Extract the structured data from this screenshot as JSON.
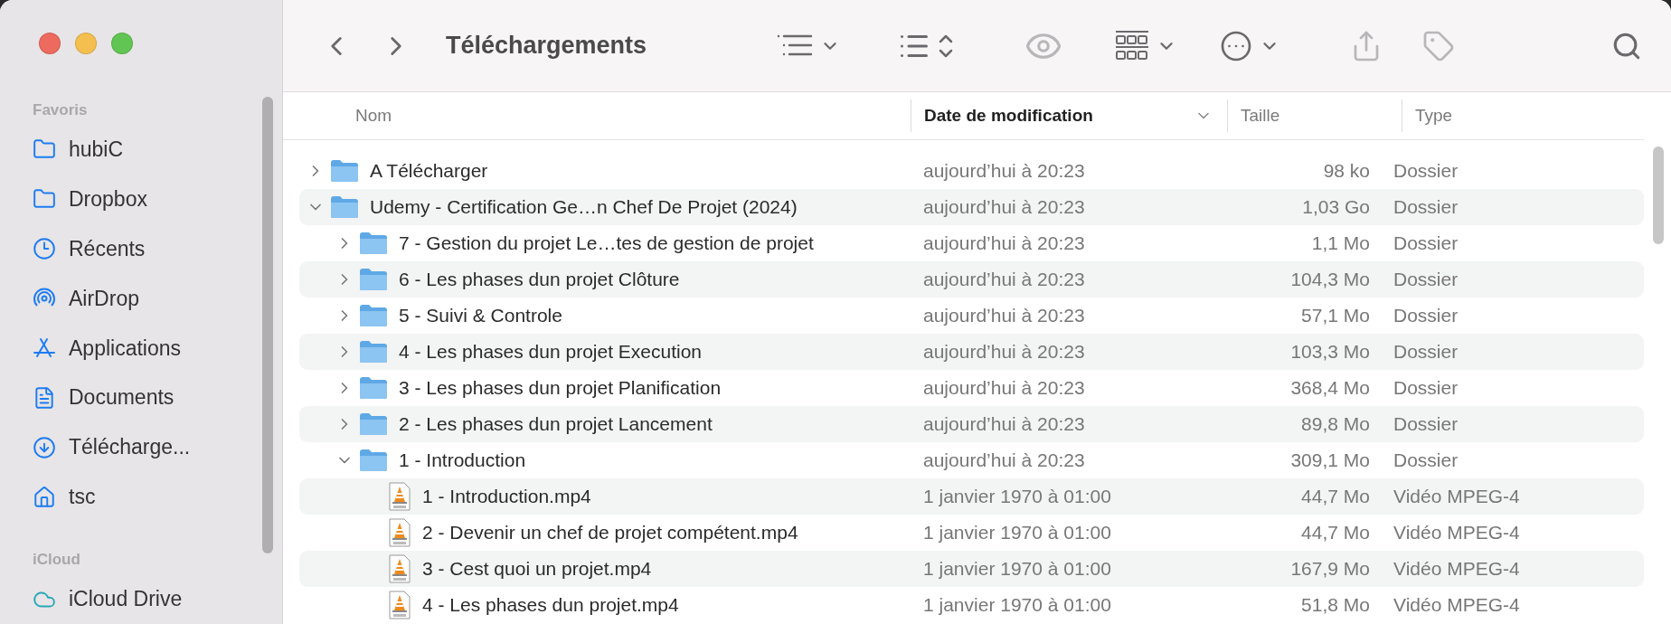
{
  "window": {
    "title": "Téléchargements"
  },
  "sidebar": {
    "sections": [
      {
        "title": "Favoris",
        "items": [
          {
            "label": "hubiC",
            "kind": "folder"
          },
          {
            "label": "Dropbox",
            "kind": "folder"
          },
          {
            "label": "Récents",
            "kind": "clock"
          },
          {
            "label": "AirDrop",
            "kind": "airdrop"
          },
          {
            "label": "Applications",
            "kind": "apps"
          },
          {
            "label": "Documents",
            "kind": "document"
          },
          {
            "label": "Télécharge...",
            "kind": "download"
          },
          {
            "label": "tsc",
            "kind": "home"
          }
        ]
      },
      {
        "title": "iCloud",
        "items": [
          {
            "label": "iCloud Drive",
            "kind": "cloud"
          }
        ]
      }
    ]
  },
  "table": {
    "columns": [
      {
        "label": "Nom",
        "sorted": false
      },
      {
        "label": "Date de modification",
        "sorted": true
      },
      {
        "label": "Taille",
        "sorted": false
      },
      {
        "label": "Type",
        "sorted": false
      }
    ],
    "rows": [
      {
        "name": "A Télécharger",
        "modified": "aujourd’hui à 20:23",
        "size": "98 ko",
        "type": "Dossier",
        "kind": "folder",
        "expanded": false
      },
      {
        "name": "Udemy - Certification Ge…n Chef De Projet (2024)",
        "modified": "aujourd’hui à 20:23",
        "size": "1,03 Go",
        "type": "Dossier",
        "kind": "folder",
        "expanded": true,
        "children": [
          {
            "name": "7 - Gestion du projet Le…tes de gestion de projet",
            "modified": "aujourd’hui à 20:23",
            "size": "1,1 Mo",
            "type": "Dossier",
            "kind": "folder",
            "expanded": false
          },
          {
            "name": "6 - Les phases dun projet Clôture",
            "modified": "aujourd’hui à 20:23",
            "size": "104,3 Mo",
            "type": "Dossier",
            "kind": "folder",
            "expanded": false
          },
          {
            "name": "5 - Suivi & Controle",
            "modified": "aujourd’hui à 20:23",
            "size": "57,1 Mo",
            "type": "Dossier",
            "kind": "folder",
            "expanded": false
          },
          {
            "name": "4 - Les phases dun projet Execution",
            "modified": "aujourd’hui à 20:23",
            "size": "103,3 Mo",
            "type": "Dossier",
            "kind": "folder",
            "expanded": false
          },
          {
            "name": "3 - Les phases dun projet Planification",
            "modified": "aujourd’hui à 20:23",
            "size": "368,4 Mo",
            "type": "Dossier",
            "kind": "folder",
            "expanded": false
          },
          {
            "name": "2 - Les phases dun projet Lancement",
            "modified": "aujourd’hui à 20:23",
            "size": "89,8 Mo",
            "type": "Dossier",
            "kind": "folder",
            "expanded": false
          },
          {
            "name": "1 - Introduction",
            "modified": "aujourd’hui à 20:23",
            "size": "309,1 Mo",
            "type": "Dossier",
            "kind": "folder",
            "expanded": true,
            "children": [
              {
                "name": "1 - Introduction.mp4",
                "modified": "1 janvier 1970 à 01:00",
                "size": "44,7 Mo",
                "type": "Vidéo MPEG-4",
                "kind": "video"
              },
              {
                "name": "2 - Devenir un chef de projet compétent.mp4",
                "modified": "1 janvier 1970 à 01:00",
                "size": "44,7 Mo",
                "type": "Vidéo MPEG-4",
                "kind": "video"
              },
              {
                "name": "3 - Cest quoi un projet.mp4",
                "modified": "1 janvier 1970 à 01:00",
                "size": "167,9 Mo",
                "type": "Vidéo MPEG-4",
                "kind": "video"
              },
              {
                "name": "4 - Les phases dun projet.mp4",
                "modified": "1 janvier 1970 à 01:00",
                "size": "51,8 Mo",
                "type": "Vidéo MPEG-4",
                "kind": "video"
              }
            ]
          }
        ]
      }
    ]
  }
}
